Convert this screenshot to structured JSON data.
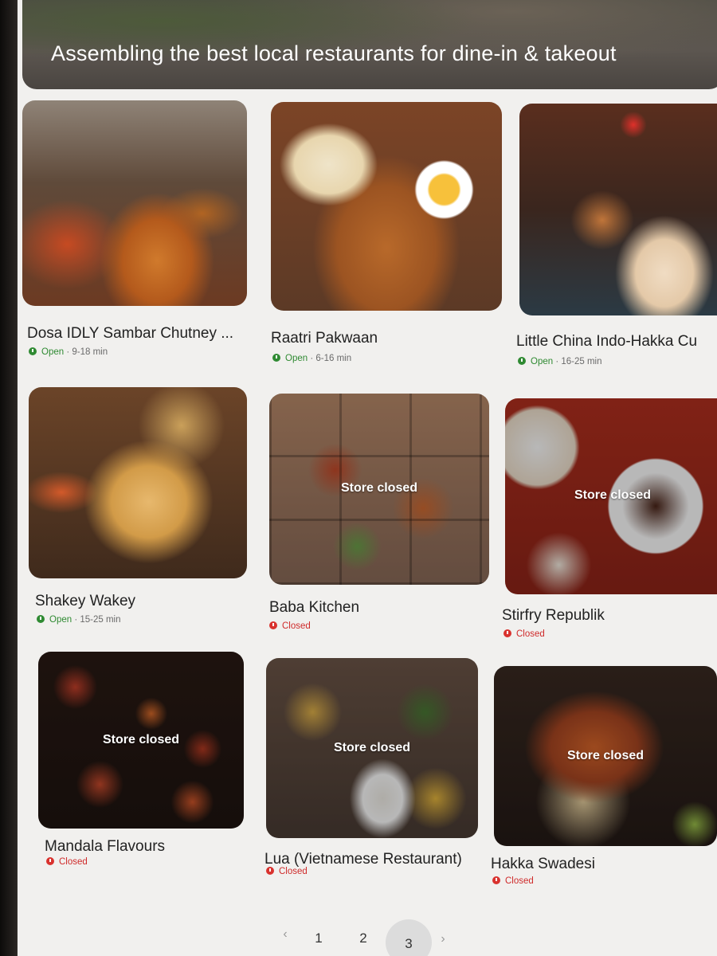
{
  "hero": {
    "title": "Assembling the best local restaurants for dine-in & takeout"
  },
  "colors": {
    "open": "#2f8a32",
    "closed": "#d9322e",
    "background": "#f1f0ee"
  },
  "restaurants": [
    {
      "name": "Dosa IDLY Sambar Chutney ...",
      "status": "Open",
      "time": "9-18 min",
      "store_closed_label": ""
    },
    {
      "name": "Raatri Pakwaan",
      "status": "Open",
      "time": "6-16 min",
      "store_closed_label": ""
    },
    {
      "name": "Little China Indo-Hakka Cu",
      "status": "Open",
      "time": "16-25 min",
      "store_closed_label": ""
    },
    {
      "name": "Shakey Wakey",
      "status": "Open",
      "time": "15-25 min",
      "store_closed_label": ""
    },
    {
      "name": "Baba Kitchen",
      "status": "Closed",
      "time": "",
      "store_closed_label": "Store closed"
    },
    {
      "name": "Stirfry Republik",
      "status": "Closed",
      "time": "",
      "store_closed_label": "Store closed"
    },
    {
      "name": "Mandala Flavours",
      "status": "Closed",
      "time": "",
      "store_closed_label": "Store closed"
    },
    {
      "name": "Lua (Vietnamese Restaurant)",
      "status": "Closed",
      "time": "",
      "store_closed_label": "Store closed"
    },
    {
      "name": "Hakka Swadesi",
      "status": "Closed",
      "time": "",
      "store_closed_label": "Store closed"
    }
  ],
  "pagination": {
    "prev": "‹",
    "pages": [
      "1",
      "2",
      "3"
    ],
    "current": "3",
    "next": "›"
  },
  "icons": {
    "status_open": "clock-icon",
    "status_closed": "clock-icon",
    "prev": "chevron-left-icon",
    "next": "chevron-right-icon"
  }
}
